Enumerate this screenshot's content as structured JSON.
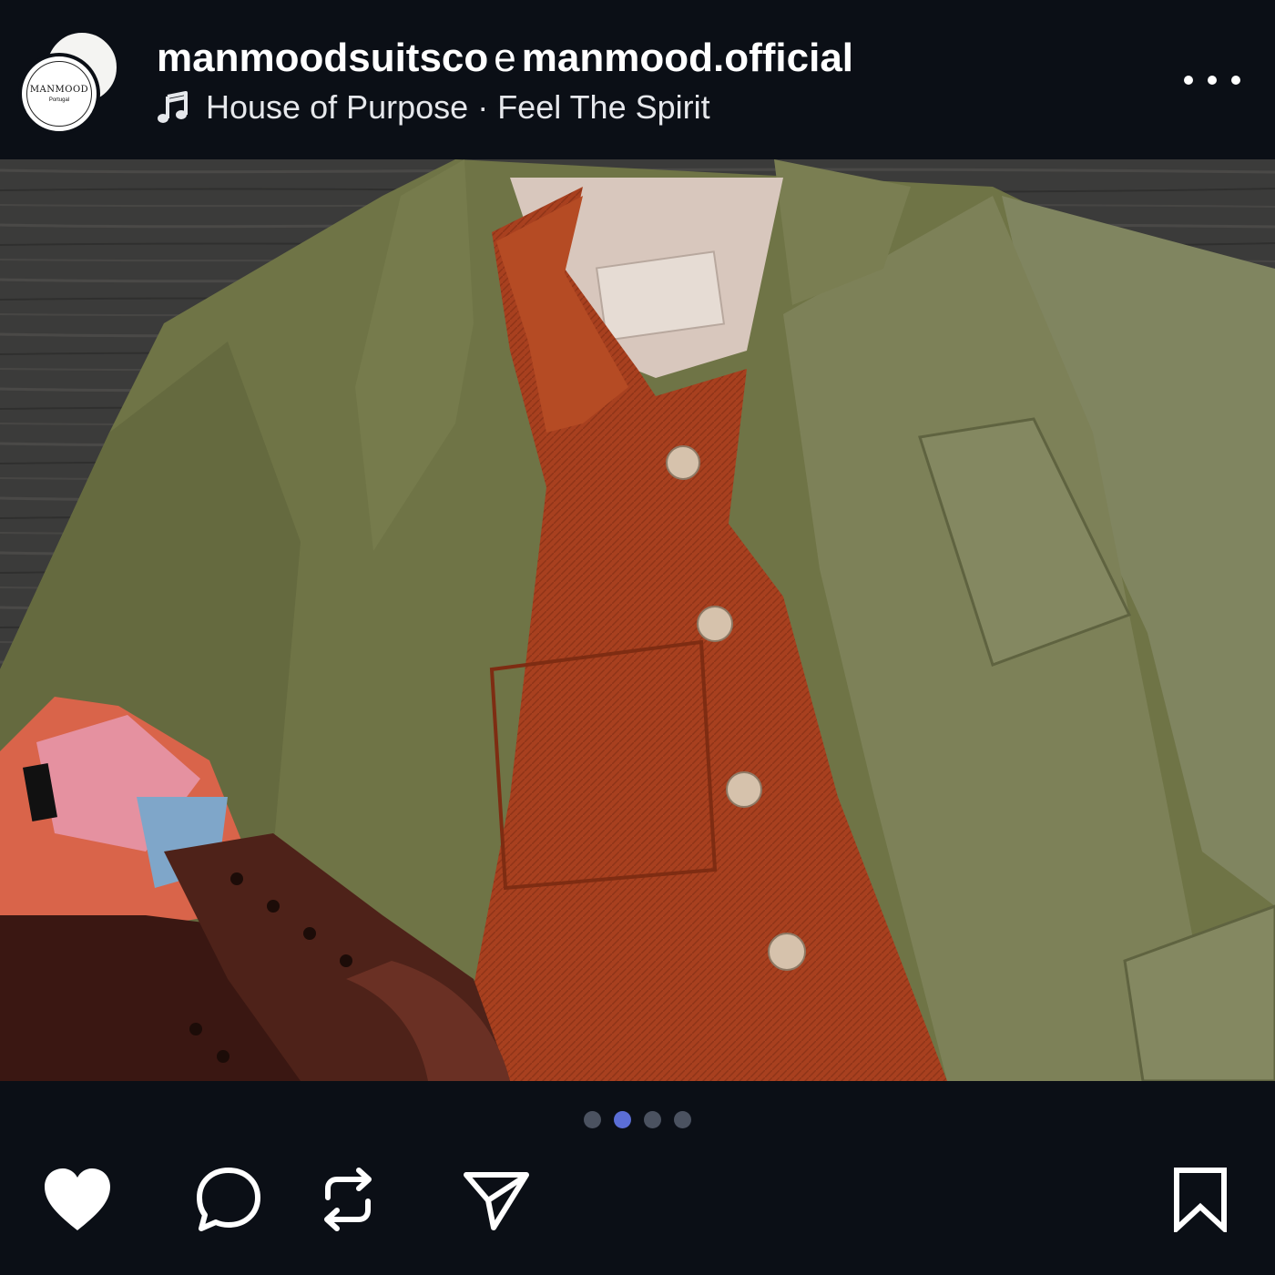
{
  "post": {
    "author_primary": "manmoodsuitsco",
    "conjunction": "e",
    "author_secondary": "manmood.official",
    "audio_artist": "House of Purpose",
    "separator": "·",
    "audio_track": "Feel The Spirit"
  },
  "avatar": {
    "brand_text": "MANMOOD",
    "subtext": "Portugal"
  },
  "carousel": {
    "total": 4,
    "active_index": 1
  },
  "actions": {
    "like_icon": "heart-filled-icon",
    "comment_icon": "comment-icon",
    "repost_icon": "repost-icon",
    "share_icon": "send-icon",
    "save_icon": "bookmark-icon"
  },
  "colors": {
    "background": "#0b0f16",
    "active_dot": "#5b6ed6",
    "inactive_dot": "#4b5260"
  }
}
